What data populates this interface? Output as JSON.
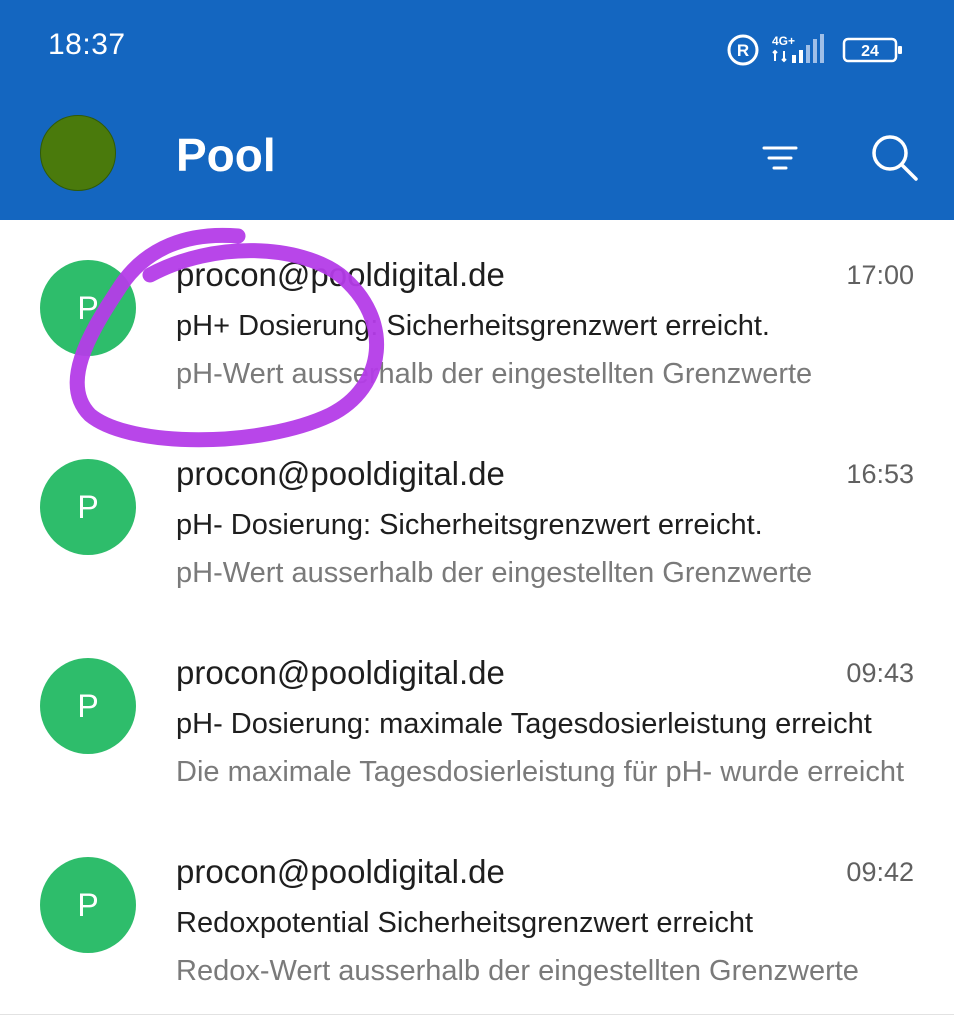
{
  "status_bar": {
    "time": "18:37",
    "roaming_label": "R",
    "network_label": "4G+",
    "battery": "24"
  },
  "app_bar": {
    "title": "Pool",
    "account_avatar_color": "#4a7a0c",
    "filter_icon": "filter-icon",
    "search_icon": "search-icon"
  },
  "colors": {
    "header_bg": "#1466c0",
    "sender_avatar_bg": "#2ebd6b",
    "annotation_stroke": "#b43ce8"
  },
  "emails": [
    {
      "avatar_letter": "P",
      "sender": "procon@pooldigital.de",
      "time": "17:00",
      "subject": "pH+ Dosierung: Sicherheitsgrenzwert erreicht.",
      "preview": "pH-Wert ausserhalb der eingestellten Grenzwerte"
    },
    {
      "avatar_letter": "P",
      "sender": "procon@pooldigital.de",
      "time": "16:53",
      "subject": "pH- Dosierung: Sicherheitsgrenzwert erreicht.",
      "preview": "pH-Wert ausserhalb der eingestellten Grenzwerte"
    },
    {
      "avatar_letter": "P",
      "sender": "procon@pooldigital.de",
      "time": "09:43",
      "subject": "pH- Dosierung: maximale Tagesdosierleistung erreicht",
      "preview": "Die maximale Tagesdosierleistung für pH- wurde erreicht"
    },
    {
      "avatar_letter": "P",
      "sender": "procon@pooldigital.de",
      "time": "09:42",
      "subject": "Redoxpotential Sicherheitsgrenzwert erreicht",
      "preview": "Redox-Wert ausserhalb der eingestellten Grenzwerte"
    }
  ]
}
